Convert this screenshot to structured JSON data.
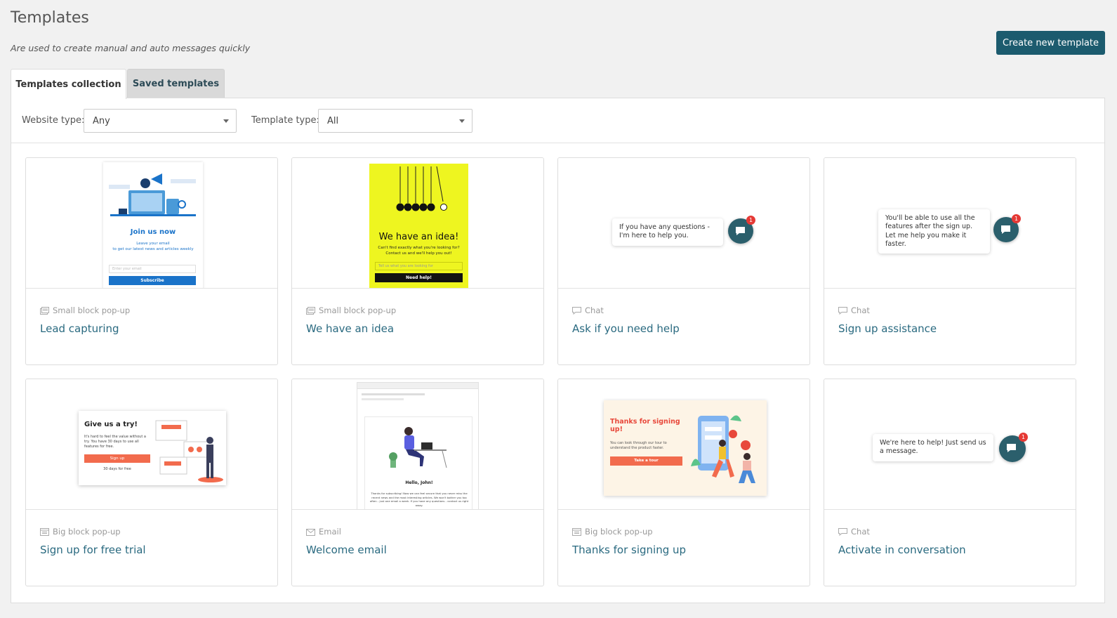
{
  "header": {
    "title": "Templates",
    "subtitle": "Are used to create manual and auto messages quickly",
    "create_button": "Create new template"
  },
  "tabs": [
    {
      "label": "Templates collection",
      "active": true
    },
    {
      "label": "Saved templates",
      "active": false
    }
  ],
  "filters": {
    "website_type_label": "Website type:",
    "website_type_value": "Any",
    "template_type_label": "Template type:",
    "template_type_value": "All"
  },
  "colors": {
    "accent": "#1c5b6e",
    "link": "#2a6a80",
    "idea_yellow": "#eef520",
    "primary_blue": "#1a73c9",
    "coral": "#f26b4d"
  },
  "cards": [
    {
      "type": "Small block pop-up",
      "type_icon": "popup-icon",
      "name": "Lead capturing"
    },
    {
      "type": "Small block pop-up",
      "type_icon": "popup-icon",
      "name": "We have an idea"
    },
    {
      "type": "Chat",
      "type_icon": "chat-icon",
      "name": "Ask if you need help"
    },
    {
      "type": "Chat",
      "type_icon": "chat-icon",
      "name": "Sign up assistance"
    },
    {
      "type": "Big block pop-up",
      "type_icon": "popup-icon",
      "name": "Sign up for free trial"
    },
    {
      "type": "Email",
      "type_icon": "envelope-icon",
      "name": "Welcome email"
    },
    {
      "type": "Big block pop-up",
      "type_icon": "popup-icon",
      "name": "Thanks for signing up"
    },
    {
      "type": "Chat",
      "type_icon": "chat-icon",
      "name": "Activate in conversation"
    }
  ],
  "previews": {
    "lead": {
      "title": "Join us now",
      "text1": "Leave your email",
      "text2": "to get our latest news and articles weekly",
      "placeholder": "Enter your email",
      "button": "Subscribe"
    },
    "idea": {
      "title": "We have an idea!",
      "text1": "Can't find exactly what you're looking for?",
      "text2": "Contact us and we'll help you out!",
      "placeholder": "Tell us what you are looking for",
      "button": "Need help!"
    },
    "ask": {
      "message": "If you have any questions - I'm here to help you.",
      "badge": "1"
    },
    "signup_assist": {
      "message": "You'll be able to use all the features after the sign up. Let me help you make it faster.",
      "badge": "1"
    },
    "trial": {
      "title": "Give us a try!",
      "text": "It's hard to feel the value without a try. You have 30 days to use all features for free.",
      "button": "Sign up",
      "footnote": "30 days for free"
    },
    "welcome": {
      "greeting": "Hello, John!",
      "text": "Thanks for subscribing! Now we can feel secure that you never miss the recent news and the most interesting articles. We won't bother you too often - just one email a week. If you have any questions - contact us right away."
    },
    "thanks": {
      "title": "Thanks for signing up!",
      "text": "You can look through our tour to understand the product faster.",
      "button": "Take a tour"
    },
    "activate": {
      "message": "We're here to help! Just send us a message.",
      "badge": "1"
    }
  }
}
